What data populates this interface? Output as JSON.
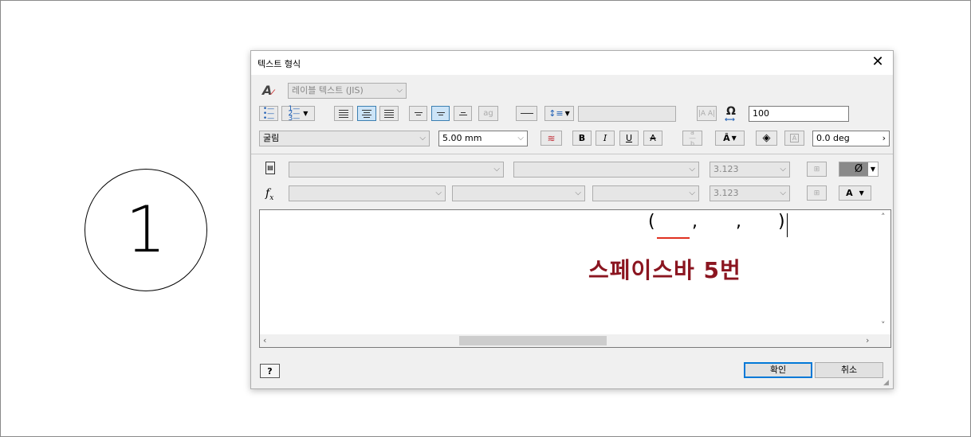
{
  "drawing": {
    "balloon_number": "1"
  },
  "dialog": {
    "title": "텍스트 형식",
    "style_select": {
      "value": "레이블 텍스트 (JIS)"
    },
    "spacing_value": "100",
    "font_select": {
      "value": "굴림"
    },
    "size_select": {
      "value": "5.00 mm"
    },
    "bold_label": "B",
    "italic_label": "I",
    "underline_label": "U",
    "strike_label": "A",
    "rotation_value": "0.0 deg",
    "param_precision_1": "3.123",
    "param_precision_2": "3.123",
    "symbol_label": "Ø",
    "text_case_label": "A",
    "fx_label": "fx",
    "editor": {
      "open_paren": "(",
      "comma_1": ",",
      "comma_2": ",",
      "close_paren": ")",
      "annotation": "스페이스바 5번",
      "annotation_color": "#8b1520"
    },
    "ok_label": "확인",
    "cancel_label": "취소",
    "help_label": "?"
  }
}
